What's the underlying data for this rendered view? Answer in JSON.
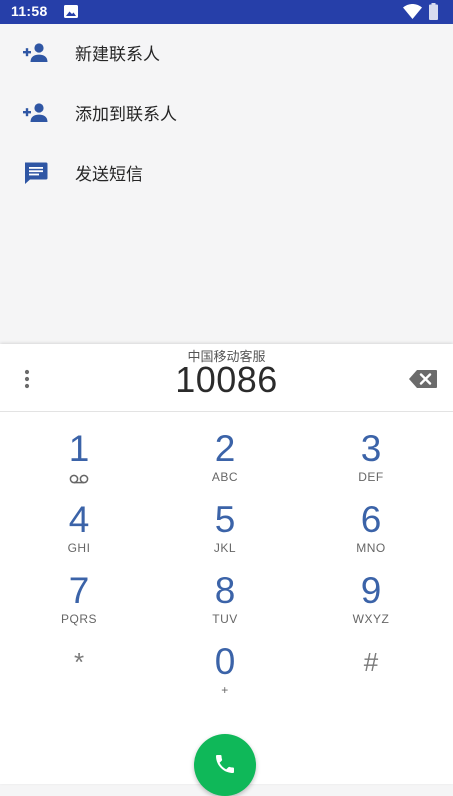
{
  "status_bar": {
    "time": "11:58",
    "bg_color": "#263fa9",
    "icons": [
      "image-icon",
      "wifi-icon",
      "battery-icon"
    ]
  },
  "actions": [
    {
      "label": "新建联系人",
      "icon": "add-contact-icon"
    },
    {
      "label": "添加到联系人",
      "icon": "add-contact-icon"
    },
    {
      "label": "发送短信",
      "icon": "message-icon"
    }
  ],
  "dialer": {
    "contact_name": "中国移动客服",
    "number": "10086",
    "accent_color": "#3b63a8",
    "call_color": "#0fb859",
    "keys": [
      {
        "digit": "1",
        "letters": ""
      },
      {
        "digit": "2",
        "letters": "ABC"
      },
      {
        "digit": "3",
        "letters": "DEF"
      },
      {
        "digit": "4",
        "letters": "GHI"
      },
      {
        "digit": "5",
        "letters": "JKL"
      },
      {
        "digit": "6",
        "letters": "MNO"
      },
      {
        "digit": "7",
        "letters": "PQRS"
      },
      {
        "digit": "8",
        "letters": "TUV"
      },
      {
        "digit": "9",
        "letters": "WXYZ"
      },
      {
        "digit": "*",
        "letters": ""
      },
      {
        "digit": "0",
        "letters": "+"
      },
      {
        "digit": "#",
        "letters": ""
      }
    ]
  }
}
